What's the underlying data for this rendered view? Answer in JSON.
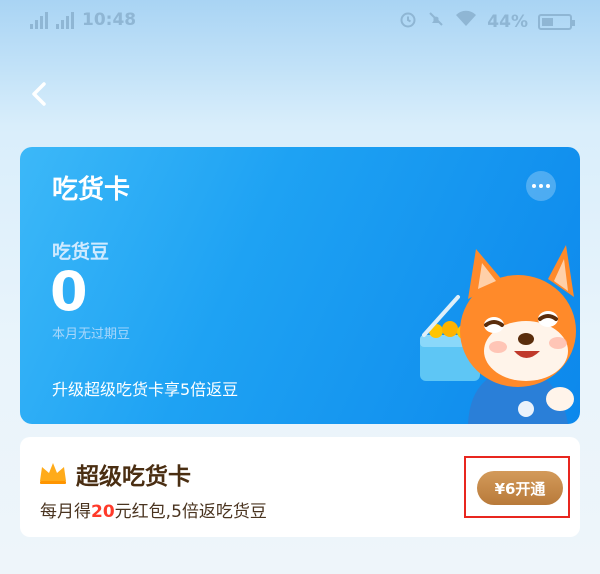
{
  "status_bar": {
    "time": "10:48",
    "battery": "44%",
    "battery_level": 0.44
  },
  "header": {
    "back_icon": "chevron-left-icon"
  },
  "card": {
    "title": "吃货卡",
    "more_icon": "more-dots-icon",
    "beans_label": "吃货豆",
    "beans_value": "0",
    "beans_note": "本月无过期豆",
    "upgrade_text": "升级超级吃货卡享5倍返豆"
  },
  "super_card": {
    "crown_icon": "crown-icon",
    "title": "超级吃货卡",
    "desc_before": "每月得",
    "desc_highlight": "20",
    "desc_after": "元红包,5倍返吃货豆",
    "button_label": "¥6开通"
  },
  "colors": {
    "card_blue": "#1ea2f3",
    "highlight_red": "#ff3a2a",
    "button_gold": "#c48845",
    "box_red": "#e8261f"
  }
}
